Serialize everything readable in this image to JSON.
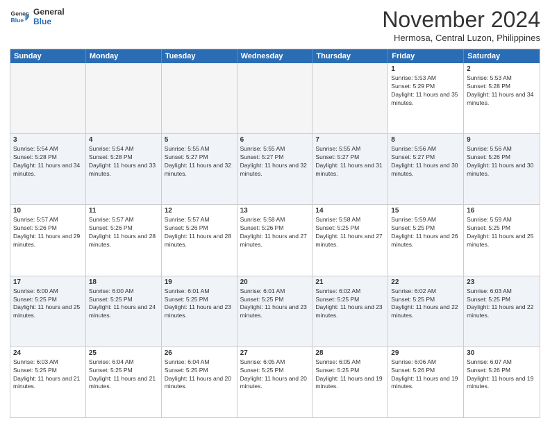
{
  "header": {
    "logo_line1": "General",
    "logo_line2": "Blue",
    "month_title": "November 2024",
    "location": "Hermosa, Central Luzon, Philippines"
  },
  "weekdays": [
    "Sunday",
    "Monday",
    "Tuesday",
    "Wednesday",
    "Thursday",
    "Friday",
    "Saturday"
  ],
  "weeks": [
    [
      {
        "day": "",
        "sunrise": "",
        "sunset": "",
        "daylight": "",
        "empty": true
      },
      {
        "day": "",
        "sunrise": "",
        "sunset": "",
        "daylight": "",
        "empty": true
      },
      {
        "day": "",
        "sunrise": "",
        "sunset": "",
        "daylight": "",
        "empty": true
      },
      {
        "day": "",
        "sunrise": "",
        "sunset": "",
        "daylight": "",
        "empty": true
      },
      {
        "day": "",
        "sunrise": "",
        "sunset": "",
        "daylight": "",
        "empty": true
      },
      {
        "day": "1",
        "sunrise": "Sunrise: 5:53 AM",
        "sunset": "Sunset: 5:29 PM",
        "daylight": "Daylight: 11 hours and 35 minutes.",
        "empty": false
      },
      {
        "day": "2",
        "sunrise": "Sunrise: 5:53 AM",
        "sunset": "Sunset: 5:28 PM",
        "daylight": "Daylight: 11 hours and 34 minutes.",
        "empty": false
      }
    ],
    [
      {
        "day": "3",
        "sunrise": "Sunrise: 5:54 AM",
        "sunset": "Sunset: 5:28 PM",
        "daylight": "Daylight: 11 hours and 34 minutes.",
        "empty": false
      },
      {
        "day": "4",
        "sunrise": "Sunrise: 5:54 AM",
        "sunset": "Sunset: 5:28 PM",
        "daylight": "Daylight: 11 hours and 33 minutes.",
        "empty": false
      },
      {
        "day": "5",
        "sunrise": "Sunrise: 5:55 AM",
        "sunset": "Sunset: 5:27 PM",
        "daylight": "Daylight: 11 hours and 32 minutes.",
        "empty": false
      },
      {
        "day": "6",
        "sunrise": "Sunrise: 5:55 AM",
        "sunset": "Sunset: 5:27 PM",
        "daylight": "Daylight: 11 hours and 32 minutes.",
        "empty": false
      },
      {
        "day": "7",
        "sunrise": "Sunrise: 5:55 AM",
        "sunset": "Sunset: 5:27 PM",
        "daylight": "Daylight: 11 hours and 31 minutes.",
        "empty": false
      },
      {
        "day": "8",
        "sunrise": "Sunrise: 5:56 AM",
        "sunset": "Sunset: 5:27 PM",
        "daylight": "Daylight: 11 hours and 30 minutes.",
        "empty": false
      },
      {
        "day": "9",
        "sunrise": "Sunrise: 5:56 AM",
        "sunset": "Sunset: 5:26 PM",
        "daylight": "Daylight: 11 hours and 30 minutes.",
        "empty": false
      }
    ],
    [
      {
        "day": "10",
        "sunrise": "Sunrise: 5:57 AM",
        "sunset": "Sunset: 5:26 PM",
        "daylight": "Daylight: 11 hours and 29 minutes.",
        "empty": false
      },
      {
        "day": "11",
        "sunrise": "Sunrise: 5:57 AM",
        "sunset": "Sunset: 5:26 PM",
        "daylight": "Daylight: 11 hours and 28 minutes.",
        "empty": false
      },
      {
        "day": "12",
        "sunrise": "Sunrise: 5:57 AM",
        "sunset": "Sunset: 5:26 PM",
        "daylight": "Daylight: 11 hours and 28 minutes.",
        "empty": false
      },
      {
        "day": "13",
        "sunrise": "Sunrise: 5:58 AM",
        "sunset": "Sunset: 5:26 PM",
        "daylight": "Daylight: 11 hours and 27 minutes.",
        "empty": false
      },
      {
        "day": "14",
        "sunrise": "Sunrise: 5:58 AM",
        "sunset": "Sunset: 5:25 PM",
        "daylight": "Daylight: 11 hours and 27 minutes.",
        "empty": false
      },
      {
        "day": "15",
        "sunrise": "Sunrise: 5:59 AM",
        "sunset": "Sunset: 5:25 PM",
        "daylight": "Daylight: 11 hours and 26 minutes.",
        "empty": false
      },
      {
        "day": "16",
        "sunrise": "Sunrise: 5:59 AM",
        "sunset": "Sunset: 5:25 PM",
        "daylight": "Daylight: 11 hours and 25 minutes.",
        "empty": false
      }
    ],
    [
      {
        "day": "17",
        "sunrise": "Sunrise: 6:00 AM",
        "sunset": "Sunset: 5:25 PM",
        "daylight": "Daylight: 11 hours and 25 minutes.",
        "empty": false
      },
      {
        "day": "18",
        "sunrise": "Sunrise: 6:00 AM",
        "sunset": "Sunset: 5:25 PM",
        "daylight": "Daylight: 11 hours and 24 minutes.",
        "empty": false
      },
      {
        "day": "19",
        "sunrise": "Sunrise: 6:01 AM",
        "sunset": "Sunset: 5:25 PM",
        "daylight": "Daylight: 11 hours and 23 minutes.",
        "empty": false
      },
      {
        "day": "20",
        "sunrise": "Sunrise: 6:01 AM",
        "sunset": "Sunset: 5:25 PM",
        "daylight": "Daylight: 11 hours and 23 minutes.",
        "empty": false
      },
      {
        "day": "21",
        "sunrise": "Sunrise: 6:02 AM",
        "sunset": "Sunset: 5:25 PM",
        "daylight": "Daylight: 11 hours and 23 minutes.",
        "empty": false
      },
      {
        "day": "22",
        "sunrise": "Sunrise: 6:02 AM",
        "sunset": "Sunset: 5:25 PM",
        "daylight": "Daylight: 11 hours and 22 minutes.",
        "empty": false
      },
      {
        "day": "23",
        "sunrise": "Sunrise: 6:03 AM",
        "sunset": "Sunset: 5:25 PM",
        "daylight": "Daylight: 11 hours and 22 minutes.",
        "empty": false
      }
    ],
    [
      {
        "day": "24",
        "sunrise": "Sunrise: 6:03 AM",
        "sunset": "Sunset: 5:25 PM",
        "daylight": "Daylight: 11 hours and 21 minutes.",
        "empty": false
      },
      {
        "day": "25",
        "sunrise": "Sunrise: 6:04 AM",
        "sunset": "Sunset: 5:25 PM",
        "daylight": "Daylight: 11 hours and 21 minutes.",
        "empty": false
      },
      {
        "day": "26",
        "sunrise": "Sunrise: 6:04 AM",
        "sunset": "Sunset: 5:25 PM",
        "daylight": "Daylight: 11 hours and 20 minutes.",
        "empty": false
      },
      {
        "day": "27",
        "sunrise": "Sunrise: 6:05 AM",
        "sunset": "Sunset: 5:25 PM",
        "daylight": "Daylight: 11 hours and 20 minutes.",
        "empty": false
      },
      {
        "day": "28",
        "sunrise": "Sunrise: 6:05 AM",
        "sunset": "Sunset: 5:25 PM",
        "daylight": "Daylight: 11 hours and 19 minutes.",
        "empty": false
      },
      {
        "day": "29",
        "sunrise": "Sunrise: 6:06 AM",
        "sunset": "Sunset: 5:26 PM",
        "daylight": "Daylight: 11 hours and 19 minutes.",
        "empty": false
      },
      {
        "day": "30",
        "sunrise": "Sunrise: 6:07 AM",
        "sunset": "Sunset: 5:26 PM",
        "daylight": "Daylight: 11 hours and 19 minutes.",
        "empty": false
      }
    ]
  ]
}
